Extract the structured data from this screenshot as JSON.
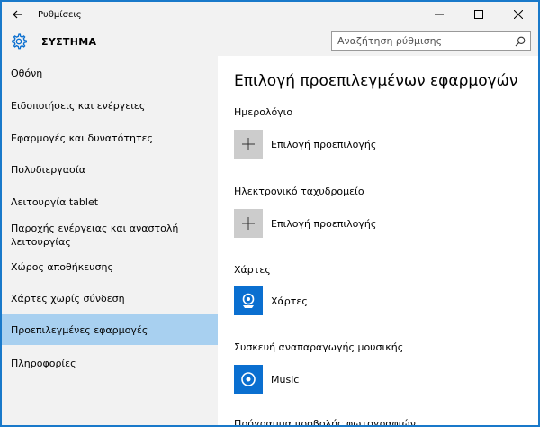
{
  "window": {
    "title": "Ρυθμίσεις"
  },
  "header": {
    "section_title": "ΣΥΣΤΗΜΑ",
    "search_placeholder": "Αναζήτηση ρύθμισης"
  },
  "sidebar": {
    "items": [
      {
        "label": "Οθόνη"
      },
      {
        "label": "Ειδοποιήσεις και ενέργειες"
      },
      {
        "label": "Εφαρμογές και δυνατότητες"
      },
      {
        "label": "Πολυδιεργασία"
      },
      {
        "label": "Λειτουργία tablet"
      },
      {
        "label": "Παροχής ενέργειας και αναστολή λειτουργίας"
      },
      {
        "label": "Χώρος αποθήκευσης"
      },
      {
        "label": "Χάρτες χωρίς σύνδεση"
      },
      {
        "label": "Προεπιλεγμένες εφαρμογές"
      },
      {
        "label": "Πληροφορίες"
      }
    ],
    "selected_index": 8
  },
  "main": {
    "title": "Επιλογή προεπιλεγμένων εφαρμογών",
    "categories": [
      {
        "label": "Ημερολόγιο",
        "app": "Επιλογή προεπιλογής",
        "icon": "plus-icon"
      },
      {
        "label": "Ηλεκτρονικό ταχυδρομείο",
        "app": "Επιλογή προεπιλογής",
        "icon": "plus-icon"
      },
      {
        "label": "Χάρτες",
        "app": "Χάρτες",
        "icon": "maps-app-icon"
      },
      {
        "label": "Συσκευή αναπαραγωγής μουσικής",
        "app": "Music",
        "icon": "music-app-icon"
      },
      {
        "label": "Πρόγραμμα προβολής φωτογραφιών"
      }
    ]
  },
  "colors": {
    "accent": "#0a6fd0",
    "selected_bg": "#a8d0f0",
    "sidebar_bg": "#f2f2f2",
    "border": "#1979ca"
  }
}
